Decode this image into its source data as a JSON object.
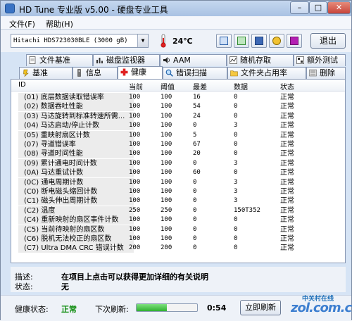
{
  "window": {
    "title": "HD Tune 专业版 v5.00 - 硬盘专业工具"
  },
  "menu": {
    "items": [
      "文件(F)",
      "帮助(H)"
    ]
  },
  "toolbar": {
    "drive": "Hitachi HDS723030BLE   (3000 gB)",
    "temperature": "24℃",
    "exit_label": "退出",
    "icons": [
      "copy-icon",
      "copy-table-icon",
      "save-icon",
      "options-icon",
      "download-icon"
    ]
  },
  "tabs_top": [
    {
      "label": "文件基准",
      "icon": "file-benchmark-icon"
    },
    {
      "label": "磁盘监视器",
      "icon": "disk-monitor-icon"
    },
    {
      "label": "AAM",
      "icon": "speaker-icon"
    },
    {
      "label": "随机存取",
      "icon": "random-access-icon"
    },
    {
      "label": "额外测试",
      "icon": "extra-tests-icon"
    }
  ],
  "tabs_bottom": [
    {
      "label": "基准",
      "icon": "benchmark-icon"
    },
    {
      "label": "信息",
      "icon": "info-icon"
    },
    {
      "label": "健康",
      "icon": "health-icon",
      "active": true
    },
    {
      "label": "错误扫描",
      "icon": "error-scan-icon"
    },
    {
      "label": "文件夹占用率",
      "icon": "folder-usage-icon"
    },
    {
      "label": "删除",
      "icon": "erase-icon"
    }
  ],
  "table": {
    "columns": [
      "ID",
      "当前",
      "阈值",
      "最差",
      "数据",
      "状态"
    ],
    "rows": [
      [
        "(01) 底层数据读取错误率",
        "100",
        "100",
        "16",
        "0",
        "正常"
      ],
      [
        "(02) 数据吞吐性能",
        "100",
        "100",
        "54",
        "0",
        "正常"
      ],
      [
        "(03) 马达旋转到标准转速所需...",
        "100",
        "100",
        "24",
        "0",
        "正常"
      ],
      [
        "(04) 马达启动/停止计数",
        "100",
        "100",
        "0",
        "3",
        "正常"
      ],
      [
        "(05) 重映射扇区计数",
        "100",
        "100",
        "5",
        "0",
        "正常"
      ],
      [
        "(07) 寻道错误率",
        "100",
        "100",
        "67",
        "0",
        "正常"
      ],
      [
        "(08) 寻道时间性能",
        "100",
        "100",
        "20",
        "0",
        "正常"
      ],
      [
        "(09) 累计通电时间计数",
        "100",
        "100",
        "0",
        "3",
        "正常"
      ],
      [
        "(0A) 马达重试计数",
        "100",
        "100",
        "60",
        "0",
        "正常"
      ],
      [
        "(0C) 通电周期计数",
        "100",
        "100",
        "0",
        "3",
        "正常"
      ],
      [
        "(C0) 断电磁头缩回计数",
        "100",
        "100",
        "0",
        "3",
        "正常"
      ],
      [
        "(C1) 磁头伸出周期计数",
        "100",
        "100",
        "0",
        "3",
        "正常"
      ],
      [
        "(C2) 温度",
        "250",
        "250",
        "0",
        "150T352",
        "正常"
      ],
      [
        "(C4) 重新映射的扇区事件计数",
        "100",
        "100",
        "0",
        "0",
        "正常"
      ],
      [
        "(C5) 当前待映射的扇区数",
        "100",
        "100",
        "0",
        "0",
        "正常"
      ],
      [
        "(C6) 脱机无法校正的扇区数",
        "100",
        "100",
        "0",
        "0",
        "正常"
      ],
      [
        "(C7) Ultra DMA CRC 错误计数",
        "200",
        "200",
        "0",
        "0",
        "正常"
      ]
    ]
  },
  "description": {
    "desc_label": "描述:",
    "desc_text": "在项目上点击可以获得更加详细的有关说明",
    "status_label": "状态:",
    "status_text": "无"
  },
  "status": {
    "health_label": "健康状态:",
    "health_value": "正常",
    "next_refresh_label": "下次刷新:",
    "countdown": "0:54",
    "progress": 0.5,
    "refresh_button": "立即刷新"
  },
  "watermark": {
    "text": "中关村在线",
    "logo": "zol.com.cn"
  }
}
